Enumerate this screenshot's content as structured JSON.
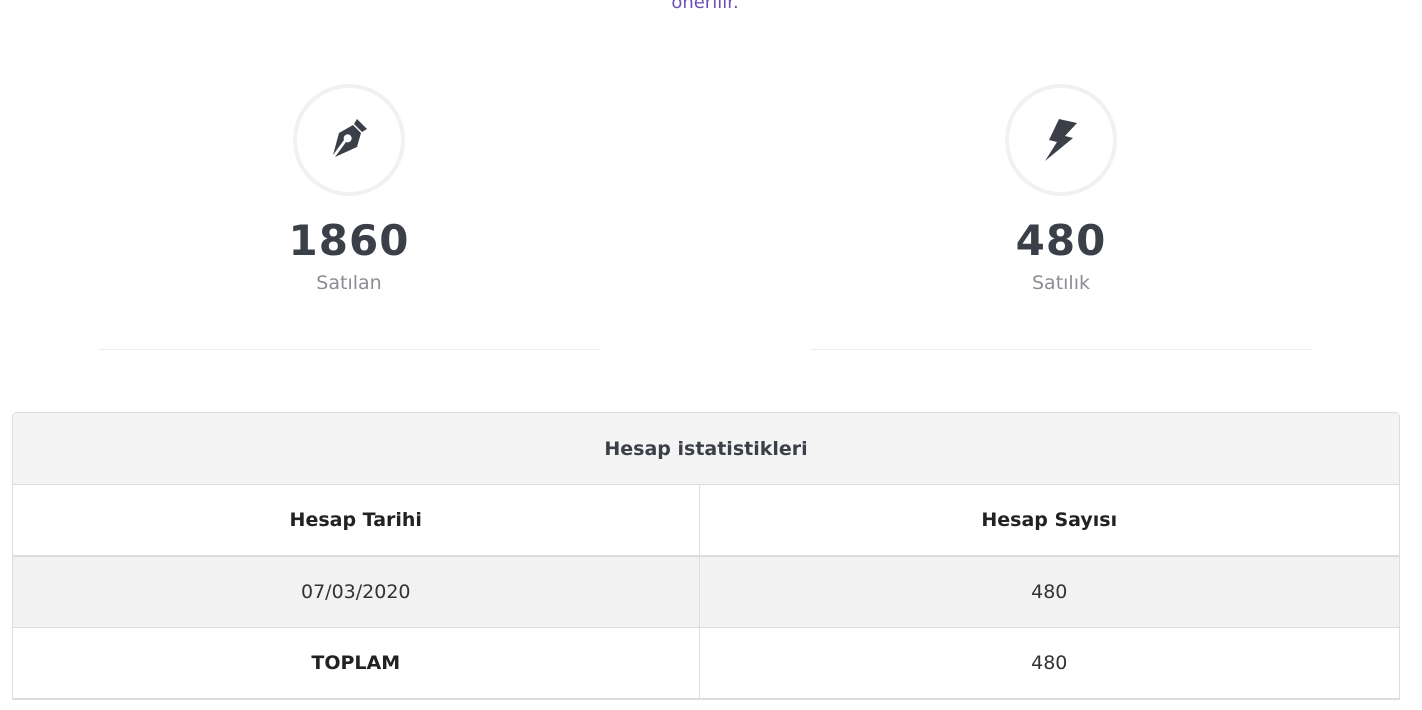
{
  "top_text": "önerilir.",
  "stats": [
    {
      "icon": "pen-nib-icon",
      "value": "1860",
      "label": "Satılan"
    },
    {
      "icon": "bolt-icon",
      "value": "480",
      "label": "Satılık"
    }
  ],
  "panel": {
    "title": "Hesap istatistikleri",
    "columns": [
      "Hesap Tarihi",
      "Hesap Sayısı"
    ],
    "rows": [
      [
        "07/03/2020",
        "480"
      ]
    ],
    "total": {
      "label": "TOPLAM",
      "value": "480"
    }
  },
  "colors": {
    "accent_text": "#6a52b5",
    "heading": "#3b3f48",
    "muted": "#8a8d93",
    "panel_bg": "#f4f4f4",
    "border": "#dddddd"
  }
}
